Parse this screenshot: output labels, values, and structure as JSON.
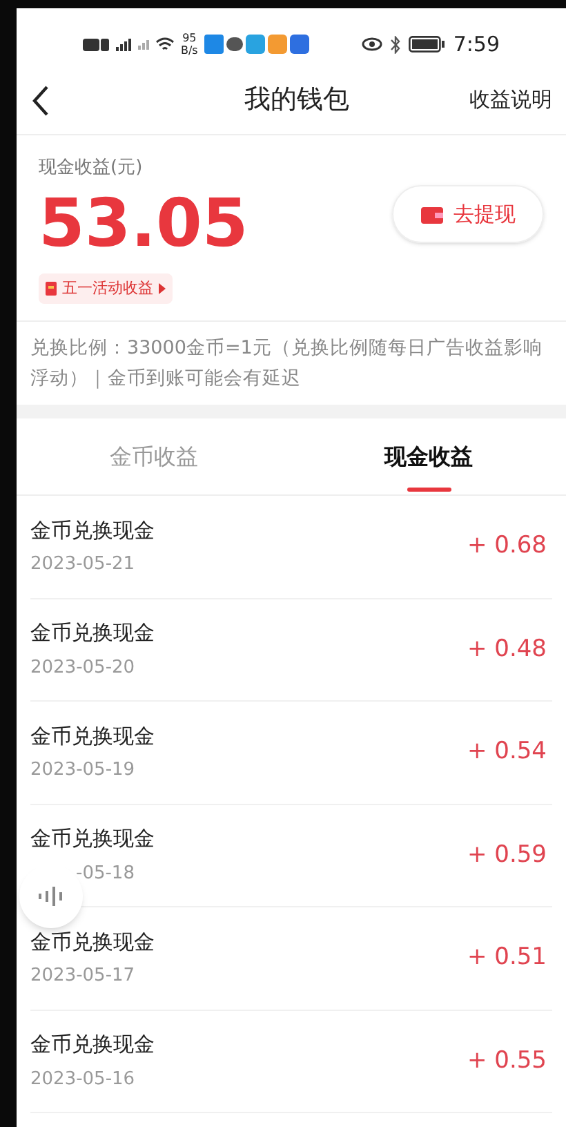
{
  "status_bar": {
    "speed": "95",
    "speed_unit": "B/s",
    "time": "7:59"
  },
  "nav": {
    "title": "我的钱包",
    "action": "收益说明"
  },
  "balance": {
    "label": "现金收益(元)",
    "amount": "53.05",
    "withdraw_button": "去提现",
    "event_link": "五一活动收益"
  },
  "notice": "兑换比例：33000金币=1元（兑换比例随每日广告收益影响浮动）｜金币到账可能会有延迟",
  "tabs": [
    {
      "label": "金币收益",
      "selected": false
    },
    {
      "label": "现金收益",
      "selected": true
    }
  ],
  "records": [
    {
      "title": "金币兑换现金",
      "date": "2023-05-21",
      "amount": "+ 0.68",
      "covered": false
    },
    {
      "title": "金币兑换现金",
      "date": "2023-05-20",
      "amount": "+ 0.48",
      "covered": false
    },
    {
      "title": "金币兑换现金",
      "date": "2023-05-19",
      "amount": "+ 0.54",
      "covered": false
    },
    {
      "title": "金币兑换现金",
      "date": "-05-18",
      "amount": "+ 0.59",
      "covered": true
    },
    {
      "title": "金币兑换现金",
      "date": "2023-05-17",
      "amount": "+ 0.51",
      "covered": false
    },
    {
      "title": "金币兑换现金",
      "date": "2023-05-16",
      "amount": "+ 0.55",
      "covered": false
    }
  ]
}
